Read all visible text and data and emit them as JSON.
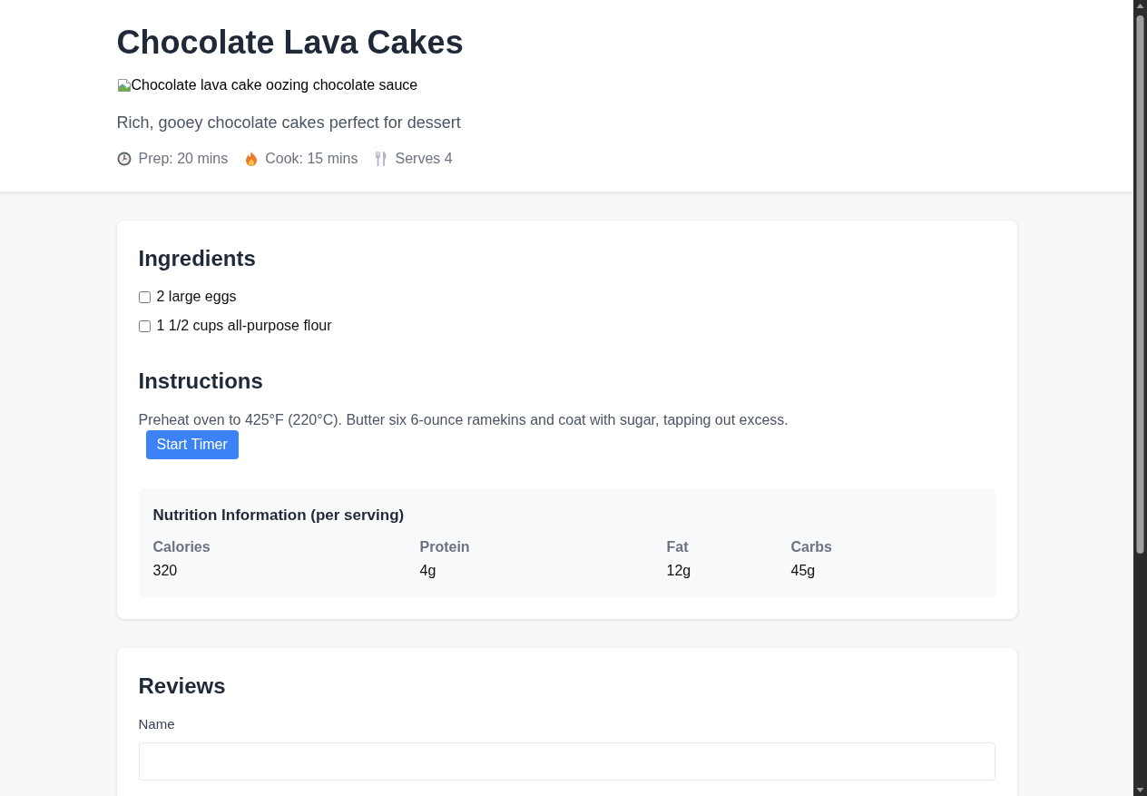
{
  "header": {
    "title": "Chocolate Lava Cakes",
    "image_alt": "Chocolate lava cake oozing chocolate sauce",
    "description": "Rich, gooey chocolate cakes perfect for dessert",
    "meta": [
      {
        "kind": "prep",
        "text": "Prep: 20 mins"
      },
      {
        "kind": "cook",
        "text": "Cook: 15 mins"
      },
      {
        "kind": "servings",
        "text": "Serves 4"
      }
    ]
  },
  "recipe": {
    "ingredients": {
      "heading": "Ingredients",
      "items": [
        {
          "text": "2 large eggs",
          "checked": false
        },
        {
          "text": "1 1/2 cups all-purpose flour",
          "checked": false
        }
      ]
    },
    "instructions": {
      "heading": "Instructions",
      "steps": [
        {
          "text": "Preheat oven to 425°F (220°C). Butter six 6-ounce ramekins and coat with sugar, tapping out excess.",
          "button": "Start Timer"
        }
      ]
    },
    "nutrition": {
      "title": "Nutrition Information (per serving)",
      "facts": [
        {
          "label": "Calories",
          "value": "320"
        },
        {
          "label": "Protein",
          "value": "4g"
        },
        {
          "label": "Fat",
          "value": "12g"
        },
        {
          "label": "Carbs",
          "value": "45g"
        }
      ]
    }
  },
  "reviews": {
    "heading": "Reviews",
    "fields": [
      {
        "label": "Name"
      }
    ]
  }
}
